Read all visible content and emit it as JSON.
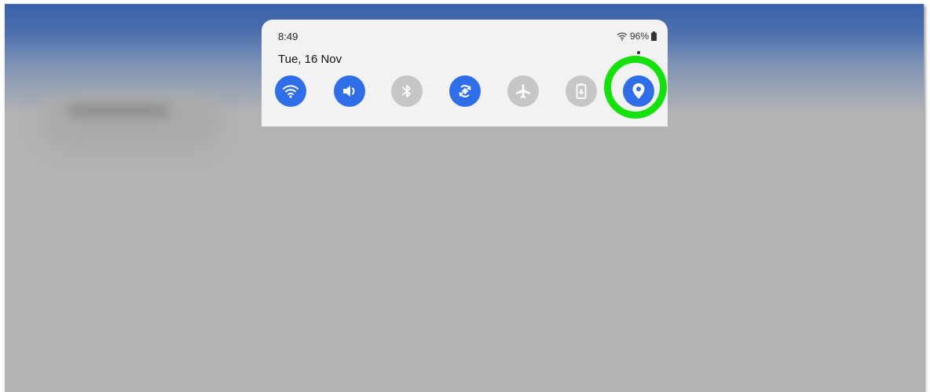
{
  "status_bar": {
    "time": "8:49",
    "battery": "96%",
    "date": "Tue, 16 Nov"
  },
  "quick_settings": {
    "tiles": [
      {
        "name": "wifi-toggle",
        "icon": "wifi-icon",
        "state": "on"
      },
      {
        "name": "sound-toggle",
        "icon": "speaker-icon",
        "state": "on"
      },
      {
        "name": "bluetooth-toggle",
        "icon": "bluetooth-icon",
        "state": "off"
      },
      {
        "name": "auto-rotate-toggle",
        "icon": "rotate-icon",
        "state": "on"
      },
      {
        "name": "airplane-mode-toggle",
        "icon": "airplane-icon",
        "state": "off"
      },
      {
        "name": "power-saving-toggle",
        "icon": "battery-saver-icon",
        "state": "off"
      },
      {
        "name": "location-toggle",
        "icon": "location-pin-icon",
        "state": "on"
      }
    ]
  },
  "colors": {
    "tile_on": "#2f6ee8",
    "tile_off": "#c6c6c6",
    "highlight_ring": "#16e10e",
    "panel": "#f2f2f3",
    "dimmed_background": "#b3b3b3"
  }
}
